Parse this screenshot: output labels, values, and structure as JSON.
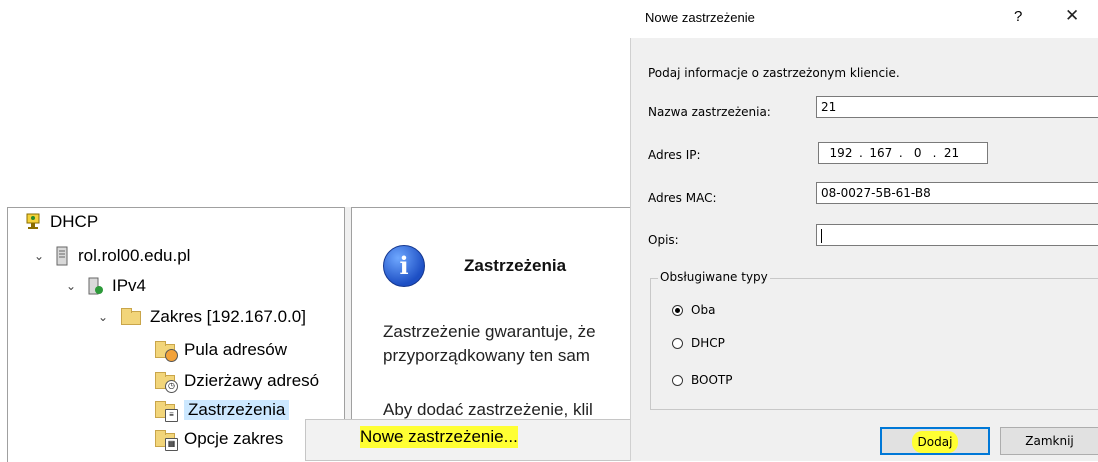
{
  "tree": {
    "root": "DHCP",
    "server": "rol.rol00.edu.pl",
    "ipv4": "IPv4",
    "scope": "Zakres [192.167.0.0]",
    "pool": "Pula adresów",
    "leases": "Dzierżawy adresó",
    "reservations": "Zastrzeżenia",
    "scope_options": "Opcje zakres"
  },
  "context_menu": {
    "new_reservation": "Nowe zastrzeżenie..."
  },
  "content": {
    "title": "Zastrzeżenia",
    "line1": "Zastrzeżenie gwarantuje, że",
    "line2": "przyporządkowany ten sam",
    "line3": "Aby dodać zastrzeżenie, klil"
  },
  "dialog": {
    "title": "Nowe zastrzeżenie",
    "help": "?",
    "close": "✕",
    "instruction": "Podaj informacje o zastrzeżonym kliencie.",
    "name_label": "Nazwa zastrzeżenia:",
    "name_value": "21",
    "ip_label": "Adres IP:",
    "ip_segments": [
      "192",
      "167",
      "0",
      "21"
    ],
    "mac_label": "Adres MAC:",
    "mac_value": "08-0027-5B-61-B8",
    "desc_label": "Opis:",
    "desc_value": "",
    "types_legend": "Obsługiwane typy",
    "types": [
      "Oba",
      "DHCP",
      "BOOTP"
    ],
    "selected_type": "Oba",
    "add_button": "Dodaj",
    "close_button": "Zamknij"
  },
  "colors": {
    "highlight": "#ffff33",
    "selection": "#cce8ff",
    "focus": "#0078d7"
  }
}
